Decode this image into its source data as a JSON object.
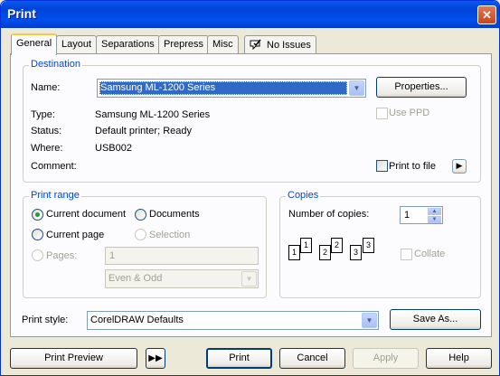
{
  "window": {
    "title": "Print",
    "close_glyph": "✕"
  },
  "tabs": [
    "General",
    "Layout",
    "Separations",
    "Prepress",
    "Misc",
    "No Issues"
  ],
  "destination": {
    "title": "Destination",
    "name_label": "Name:",
    "name_value": "Samsung ML-1200 Series",
    "properties_label": "Properties...",
    "use_ppd_label": "Use PPD",
    "type_label": "Type:",
    "type_value": "Samsung ML-1200 Series",
    "status_label": "Status:",
    "status_value": "Default printer; Ready",
    "where_label": "Where:",
    "where_value": "USB002",
    "comment_label": "Comment:",
    "print_to_file_label": "Print to file"
  },
  "print_range": {
    "title": "Print range",
    "current_document": "Current document",
    "documents": "Documents",
    "current_page": "Current page",
    "selection": "Selection",
    "pages_label": "Pages:",
    "pages_value": "1",
    "even_odd_value": "Even & Odd"
  },
  "copies": {
    "title": "Copies",
    "number_label": "Number of copies:",
    "number_value": "1",
    "collate_label": "Collate",
    "page_numbers": [
      "1",
      "1",
      "2",
      "2",
      "3",
      "3"
    ]
  },
  "print_style": {
    "label": "Print style:",
    "value": "CorelDRAW Defaults",
    "save_as_label": "Save As..."
  },
  "footer": {
    "print_preview_label": "Print Preview",
    "print_label": "Print",
    "cancel_label": "Cancel",
    "apply_label": "Apply",
    "help_label": "Help"
  }
}
